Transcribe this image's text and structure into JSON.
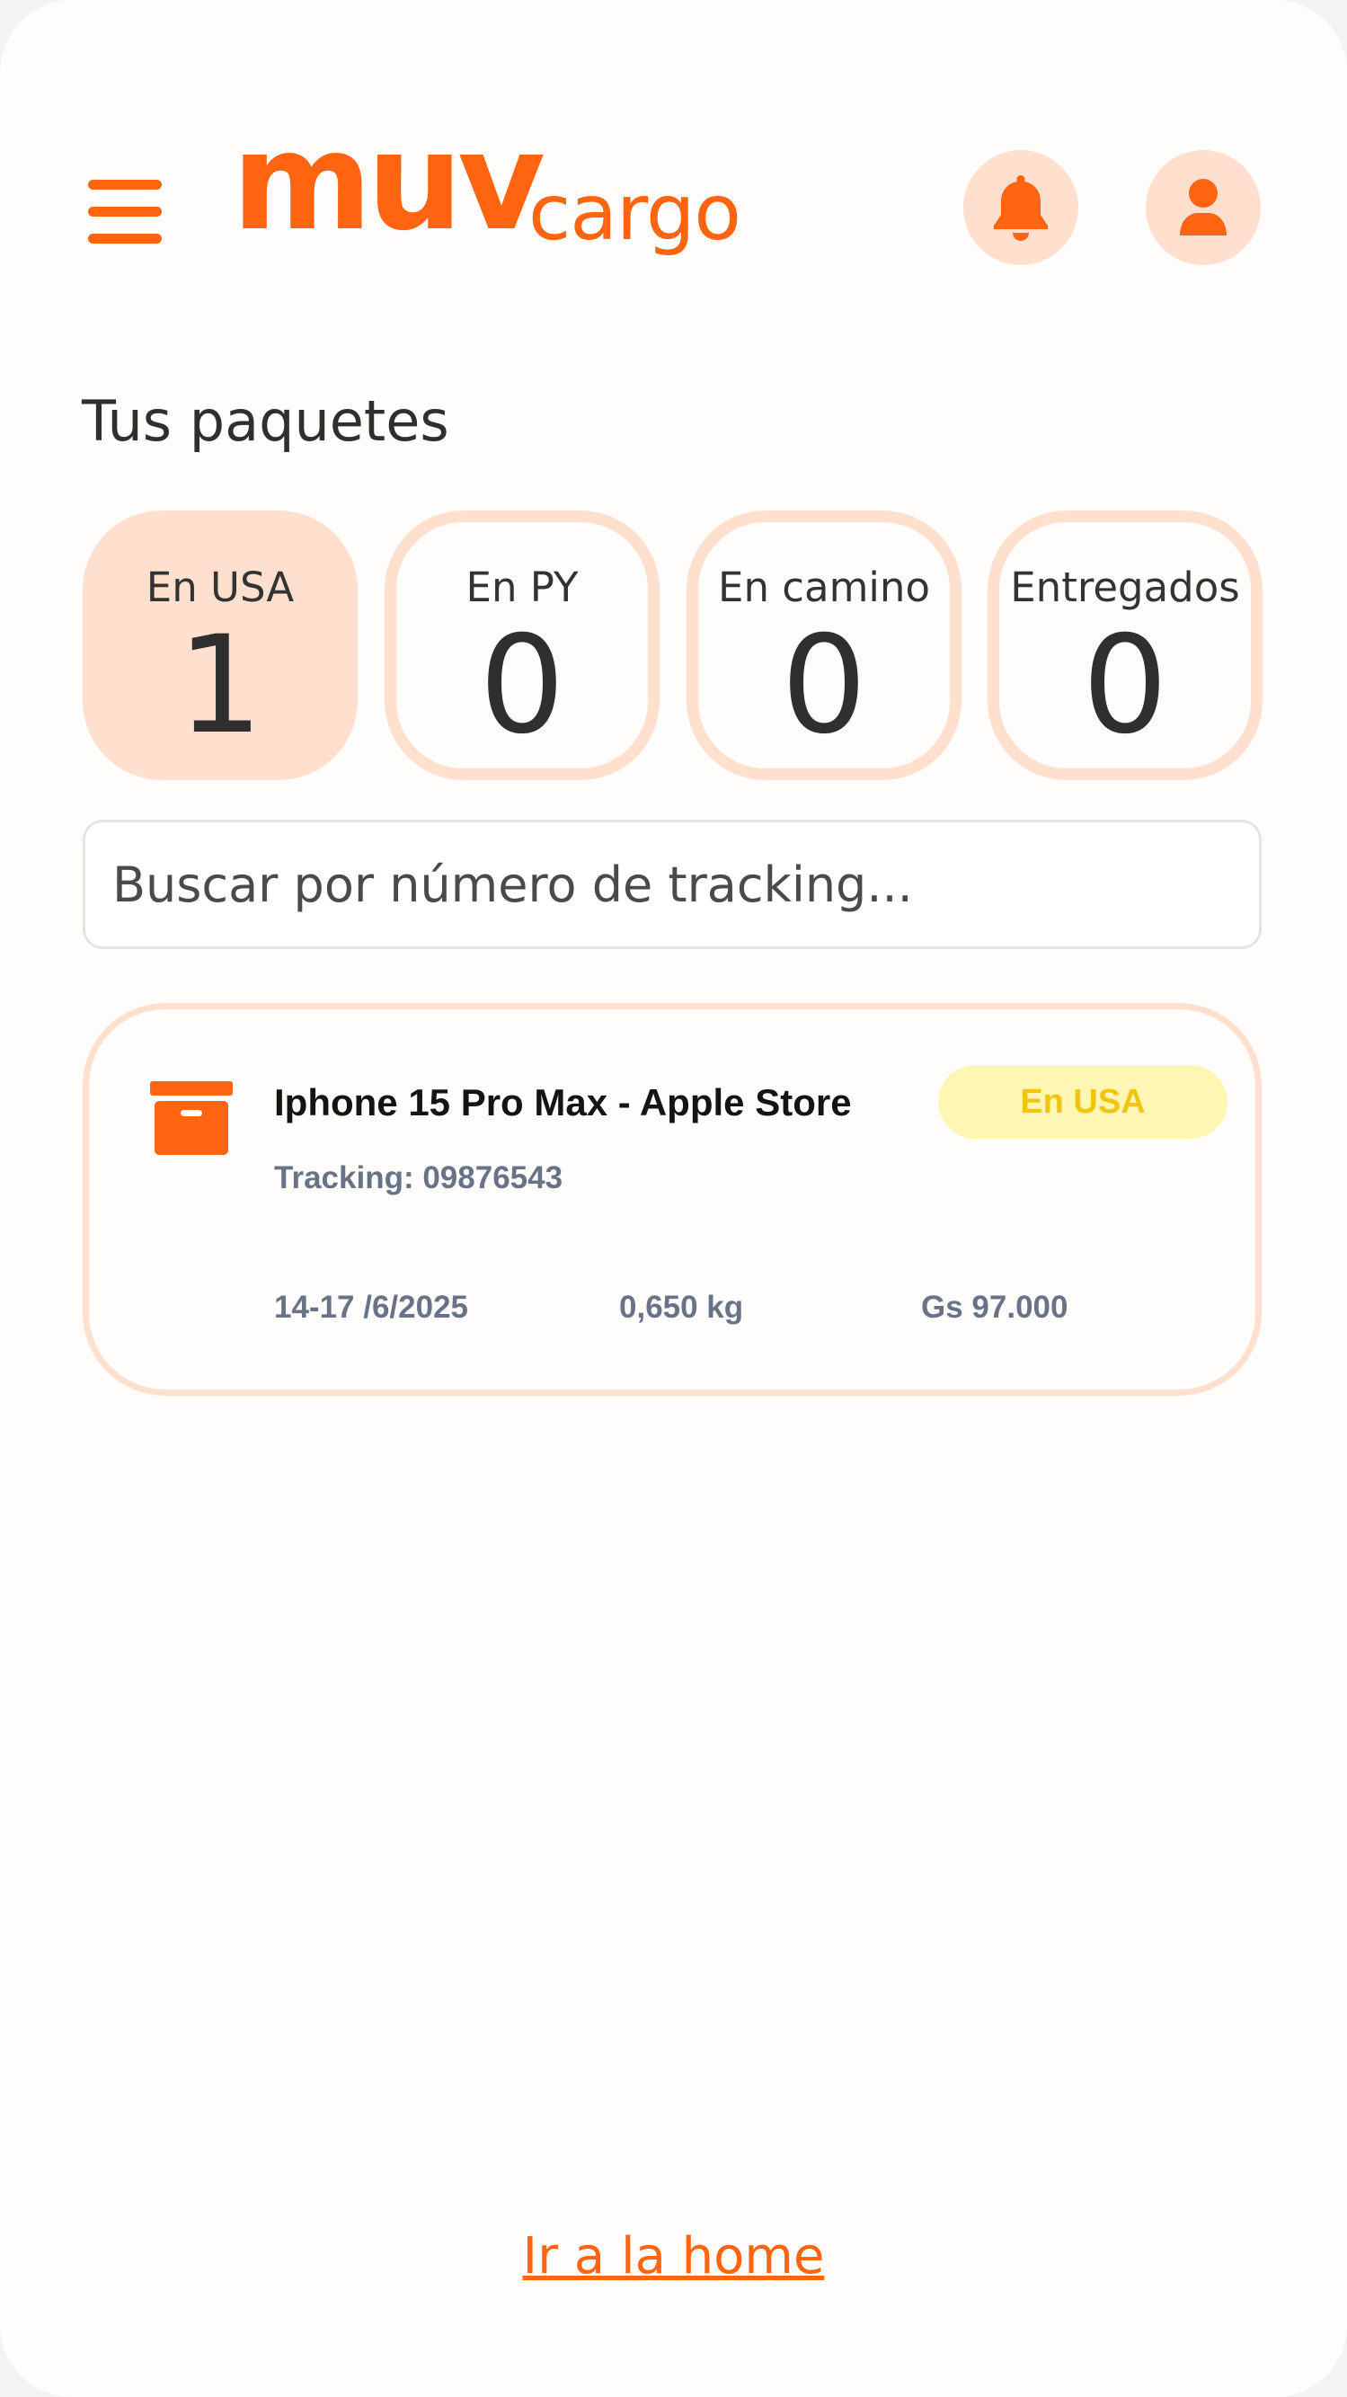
{
  "colors": {
    "brand": "#ff6410",
    "brand_soft": "#ffe0cf",
    "badge_bg": "#fff6b3",
    "badge_text": "#f1c50e",
    "muted_text": "#687387"
  },
  "header": {
    "logo_primary": "muv",
    "logo_secondary": "cargo",
    "menu_icon": "hamburger-menu-icon",
    "notifications_icon": "bell-icon",
    "profile_icon": "user-icon"
  },
  "page": {
    "title": "Tus paquetes"
  },
  "tabs": [
    {
      "label": "En USA",
      "count": "1",
      "active": true
    },
    {
      "label": "En PY",
      "count": "0",
      "active": false
    },
    {
      "label": "En camino",
      "count": "0",
      "active": false
    },
    {
      "label": "Entregados",
      "count": "0",
      "active": false
    }
  ],
  "search": {
    "placeholder": "Buscar por número de tracking...",
    "value": ""
  },
  "packages": [
    {
      "icon": "archive-box-icon",
      "name": "Iphone 15 Pro Max - Apple Store",
      "tracking": "Tracking: 09876543",
      "status": "En USA",
      "date": "14-17 /6/2025",
      "weight": "0,650 kg",
      "price": "Gs 97.000"
    }
  ],
  "footer": {
    "home_link": "Ir a la home"
  }
}
